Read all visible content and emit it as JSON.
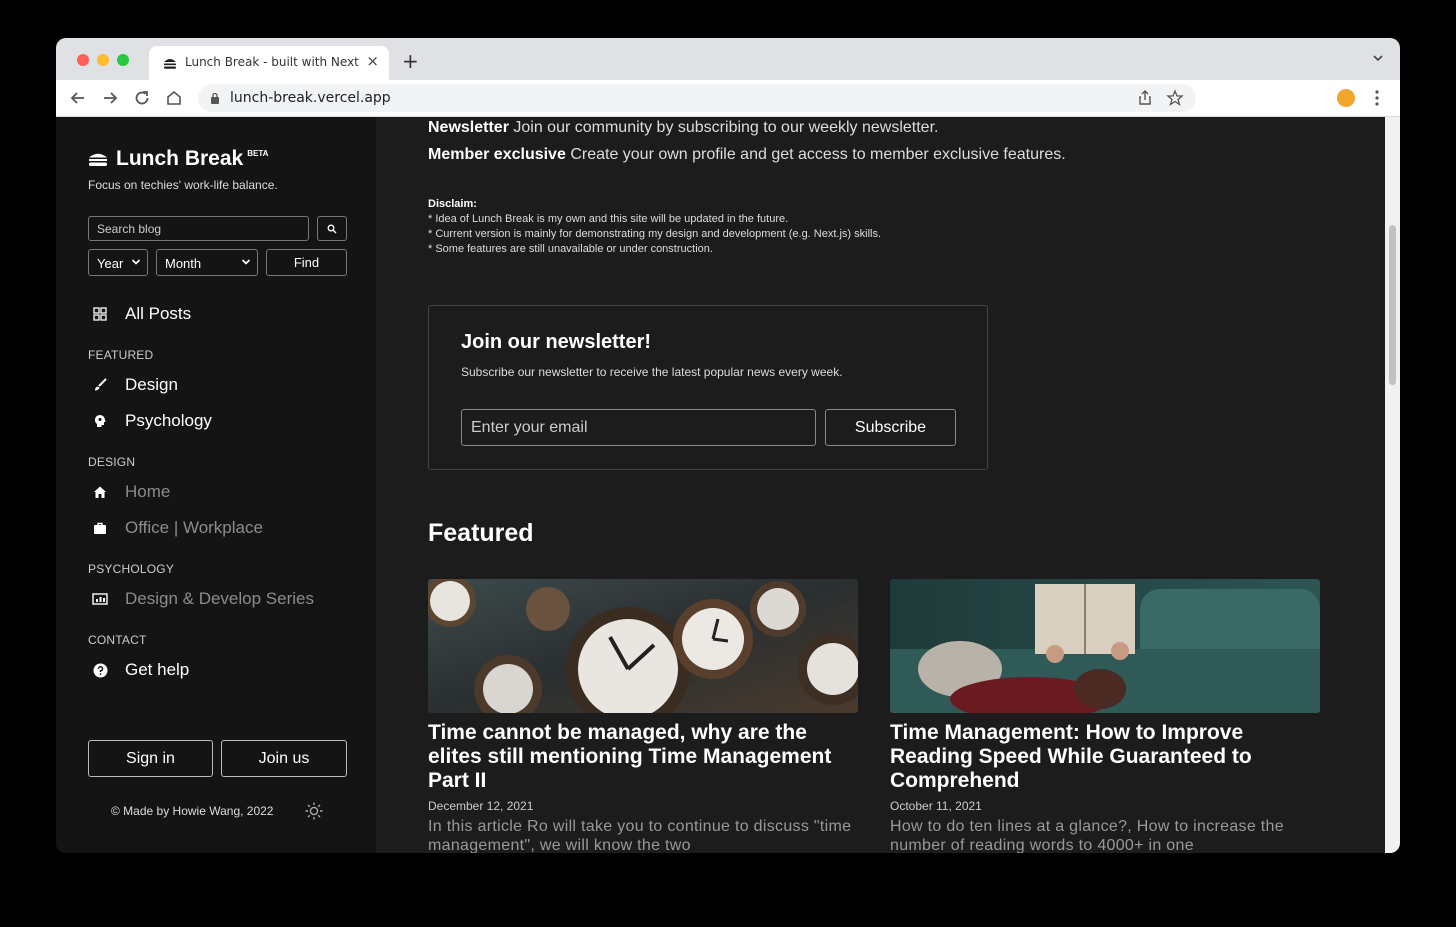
{
  "browser": {
    "tab_title": "Lunch Break - built with Next",
    "url": "lunch-break.vercel.app"
  },
  "sidebar": {
    "logo": "Lunch Break",
    "beta": "BETA",
    "tagline": "Focus on techies' work-life balance.",
    "search_placeholder": "Search blog",
    "year_label": "Year",
    "month_label": "Month",
    "find_label": "Find",
    "all_posts": "All Posts",
    "sections": {
      "featured": "FEATURED",
      "design": "DESIGN",
      "psychology": "PSYCHOLOGY",
      "contact": "CONTACT"
    },
    "items": {
      "design": "Design",
      "psychology": "Psychology",
      "home": "Home",
      "office": "Office | Workplace",
      "series": "Design & Develop Series",
      "help": "Get help"
    },
    "sign_in": "Sign in",
    "join_us": "Join us",
    "copyright": "© Made by Howie Wang, 2022"
  },
  "main": {
    "features": [
      {
        "title": "Newsletter",
        "desc": "Join our community by subscribing to our weekly newsletter."
      },
      {
        "title": "Member exclusive",
        "desc": "Create your own profile and get access to member exclusive features."
      }
    ],
    "disclaim_title": "Disclaim:",
    "disclaim_lines": [
      "* Idea of Lunch Break is my own and this site will be updated in the future.",
      "* Current version is mainly for demonstrating my design and development (e.g. Next.js) skills.",
      "* Some features are still unavailable or under construction."
    ],
    "newsletter": {
      "title": "Join our newsletter!",
      "subtitle": "Subscribe our newsletter to receive the latest popular news every week.",
      "placeholder": "Enter your email",
      "button": "Subscribe"
    },
    "featured_heading": "Featured",
    "posts": [
      {
        "title": "Time cannot be managed, why are the elites still mentioning Time Management Part II",
        "date": "December 12, 2021",
        "excerpt": "In this article Ro will take you to continue to discuss \"time management\", we will know the two"
      },
      {
        "title": "Time Management: How to Improve Reading Speed While Guaranteed to Comprehend",
        "date": "October 11, 2021",
        "excerpt": "How to do ten lines at a glance?, How to increase the number of reading words to 4000+ in one"
      }
    ]
  }
}
